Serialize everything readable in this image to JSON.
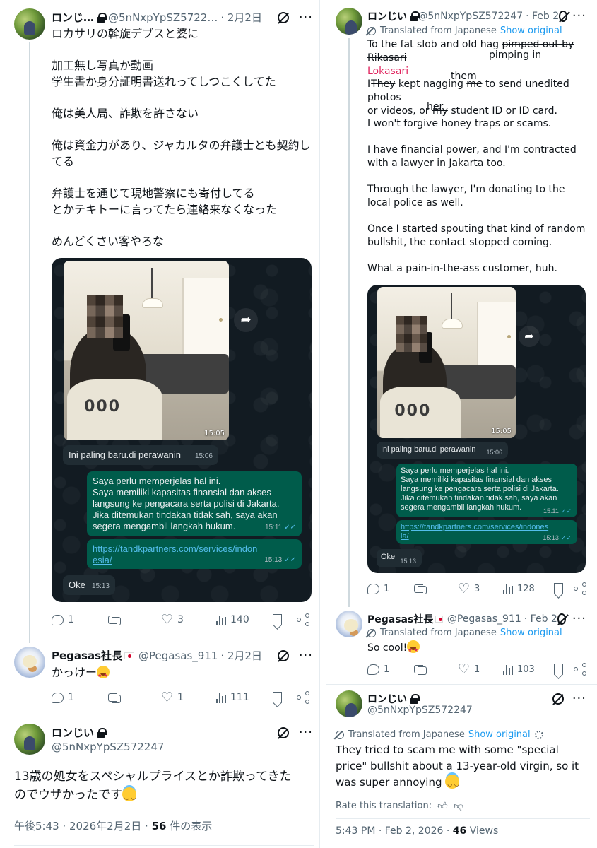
{
  "left": {
    "tweet1": {
      "name": "ロンじ…",
      "handle": "@5nNxpYpSZ5722…",
      "date": "· 2月2日",
      "lines": [
        "ロカサリの斡旋デブスと婆に",
        "",
        "加工無し写真か動画",
        "学生書か身分証明書送れってしつこくしてた",
        "",
        "俺は美人局、詐欺を許さない",
        "",
        "俺は資金力があり、ジャカルタの弁護士とも契約し",
        "てる",
        "",
        "弁護士を通じて現地警察にも寄付してる",
        "とかテキトーに言ってたら連絡来なくなった",
        "",
        "めんどくさい客やろな"
      ],
      "media": {
        "photo_time": "15:05",
        "bubble_in_1": {
          "text": "Ini paling baru.di perawanin",
          "time": "15:06"
        },
        "bubble_out_1": {
          "text": "Saya perlu memperjelas hal ini.\nSaya memiliki kapasitas finansial dan akses langsung ke pengacara serta polisi di Jakarta.\nJika ditemukan tindakan tidak sah, saya akan segera mengambil langkah hukum.",
          "time": "15:11",
          "ticks": "✓✓"
        },
        "bubble_out_2": {
          "link": "https://tandkpartners.com/services/indonesia/",
          "time": "15:13",
          "ticks": "✓✓"
        },
        "bubble_in_2": {
          "text": "Oke",
          "time": "15:13"
        },
        "forward_icon": "forward-arrow"
      },
      "actions": {
        "replies": "1",
        "reposts": "",
        "likes": "3",
        "views": "140"
      }
    },
    "tweet2": {
      "name": "Pegasas社長",
      "handle": "@Pegasas_911",
      "date": "· 2月2日",
      "text": "かっけー",
      "actions": {
        "replies": "1",
        "reposts": "",
        "likes": "1",
        "views": "111"
      }
    },
    "tweet3": {
      "name": "ロンじい",
      "handle": "@5nNxpYpSZ572247",
      "text_line1": "13歳の処女をスペシャルプライスとか詐欺ってきた",
      "text_line2": "のでウザかったです",
      "meta_time": "午後5:43 · 2026年2月2日 · ",
      "meta_views": "56",
      "meta_views_label": " 件の表示"
    }
  },
  "right": {
    "tweet1": {
      "name": "ロンじい",
      "handle": "@5nNxpYpSZ572247",
      "date": "· Feb 2",
      "translated_label": "Translated from Japanese",
      "show_original": "Show original",
      "line1_a": "To the fat slob and old hag ",
      "line1_strike": "pimped out by",
      "annot_pimping": "pimping in",
      "rikasari_strike": "Rikasari",
      "lokasari": "Lokasari",
      "annot_them": "them",
      "i_prefix": "I",
      "they_strike": "They",
      "line3_a": " kept nagging ",
      "me_strike": "me",
      "line3_b": " to send unedited photos",
      "line4_a": "or videos, or ",
      "my_strike": "my",
      "line4_b": " student ID or ID card.",
      "annot_her": "her",
      "paras": [
        "I won't forgive honey traps or scams.",
        "I have financial power, and I'm contracted with a lawyer in Jakarta too.",
        "Through the lawyer, I'm donating to the local police as well.",
        "Once I started spouting that kind of random bullshit, the contact stopped coming.",
        "What a pain-in-the-ass customer, huh."
      ],
      "actions": {
        "replies": "1",
        "reposts": "",
        "likes": "3",
        "views": "128"
      }
    },
    "tweet2": {
      "name": "Pegasas社長",
      "handle": "@Pegasas_911",
      "date": "· Feb 2",
      "translated_label": "Translated from Japanese",
      "show_original": "Show original",
      "text": "So cool!",
      "actions": {
        "replies": "1",
        "reposts": "",
        "likes": "1",
        "views": "103"
      }
    },
    "tweet3": {
      "name": "ロンじい",
      "handle": "@5nNxpYpSZ572247",
      "translated_label": "Translated from Japanese",
      "show_original": "Show original",
      "text": "They tried to scam me with some \"special price\" bullshit about a 13-year-old virgin, so it was super annoying",
      "rate_label": "Rate this translation:",
      "meta_time": "5:43 PM · Feb 2, 2026 · ",
      "meta_views": "46",
      "meta_views_label": " Views"
    }
  }
}
